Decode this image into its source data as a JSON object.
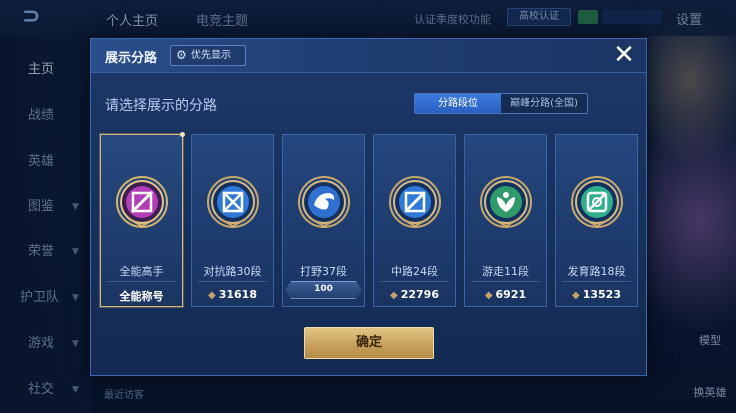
{
  "topbar": {
    "tabs": [
      "个人主页",
      "电竞主题"
    ],
    "auth_text": "认证季度校功能",
    "school_badge": "高校认证",
    "settings": "设置"
  },
  "sidebar": {
    "items": [
      {
        "label": "主页"
      },
      {
        "label": "战绩"
      },
      {
        "label": "英雄"
      },
      {
        "label": "图鉴"
      },
      {
        "label": "荣誉"
      },
      {
        "label": "护卫队"
      },
      {
        "label": "游戏"
      },
      {
        "label": "社交"
      }
    ]
  },
  "right_panel": {
    "model_label": "模型",
    "swap_label": "换英雄"
  },
  "bottom": {
    "visitors": "最近访客"
  },
  "modal": {
    "title": "展示分路",
    "priority_button": "优先显示",
    "prompt": "请选择展示的分路",
    "toggle": {
      "options": [
        "分路段位",
        "巅峰分路(全国)"
      ],
      "active_index": 0
    },
    "cards": [
      {
        "label": "全能高手",
        "value": "全能称号",
        "selected": true,
        "icon": "all-round-emblem-icon",
        "color": "#b23fb8"
      },
      {
        "label": "对抗路30段",
        "value": "31618",
        "icon": "clash-lane-emblem-icon",
        "color": "#2f7ad9"
      },
      {
        "label": "打野37段",
        "value": "",
        "rank": "100",
        "icon": "jungle-emblem-icon",
        "color": "#2f6fd0"
      },
      {
        "label": "中路24段",
        "value": "22796",
        "icon": "mid-lane-emblem-icon",
        "color": "#2f7ad9"
      },
      {
        "label": "游走11段",
        "value": "6921",
        "icon": "roam-emblem-icon",
        "color": "#2f9b6a"
      },
      {
        "label": "发育路18段",
        "value": "13523",
        "icon": "farm-lane-emblem-icon",
        "color": "#2fb08a"
      }
    ],
    "confirm_button": "确定"
  }
}
